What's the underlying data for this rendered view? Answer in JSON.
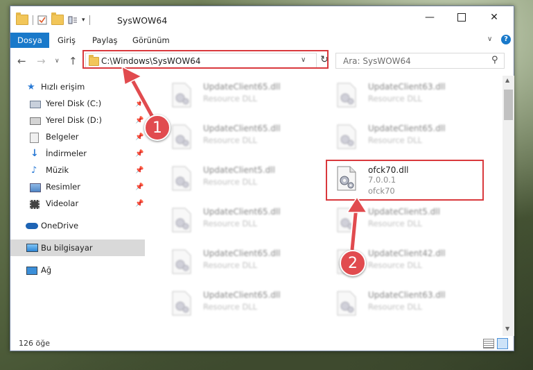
{
  "window": {
    "title": "SysWOW64"
  },
  "ribbon": {
    "tabs": [
      "Dosya",
      "Giriş",
      "Paylaş",
      "Görünüm"
    ]
  },
  "address": {
    "path": "C:\\Windows\\SysWOW64"
  },
  "search": {
    "placeholder": "Ara: SysWOW64"
  },
  "sidebar": {
    "quick_access": "Hızlı erişim",
    "items": [
      {
        "label": "Yerel Disk (C:)",
        "pinned": true
      },
      {
        "label": "Yerel Disk (D:)",
        "pinned": true
      },
      {
        "label": "Belgeler",
        "pinned": true
      },
      {
        "label": "İndirmeler",
        "pinned": true
      },
      {
        "label": "Müzik",
        "pinned": true
      },
      {
        "label": "Resimler",
        "pinned": true
      },
      {
        "label": "Videolar",
        "pinned": true
      }
    ],
    "onedrive": "OneDrive",
    "this_pc": "Bu bilgisayar",
    "network": "Ağ"
  },
  "files": {
    "left_column": [
      {
        "name": "UpdateClient65.dll",
        "desc": "Resource DLL"
      },
      {
        "name": "UpdateClient65.dll",
        "desc": "Resource DLL"
      },
      {
        "name": "UpdateClient5.dll",
        "desc": "Resource DLL"
      },
      {
        "name": "UpdateClient65.dll",
        "desc": "Resource DLL"
      },
      {
        "name": "UpdateClient65.dll",
        "desc": "Resource DLL"
      },
      {
        "name": "UpdateClient65.dll",
        "desc": "Resource DLL"
      }
    ],
    "right_column": [
      {
        "name": "UpdateClient63.dll",
        "desc": "Resource DLL"
      },
      {
        "name": "UpdateClient65.dll",
        "desc": "Resource DLL"
      },
      {
        "name": "UpdateClient5.dll",
        "desc": "Resource DLL"
      },
      {
        "name": "UpdateClient42.dll",
        "desc": "Resource DLL"
      },
      {
        "name": "UpdateClient63.dll",
        "desc": "Resource DLL"
      }
    ],
    "target": {
      "name": "ofck70.dll",
      "version": "7.0.0.1",
      "company": "ofck70"
    }
  },
  "status": {
    "count": "126 öğe"
  },
  "callouts": {
    "one": "1",
    "two": "2"
  },
  "colors": {
    "accent": "#1979ca",
    "highlight": "#d9383c",
    "callout": "#e14b4f"
  }
}
